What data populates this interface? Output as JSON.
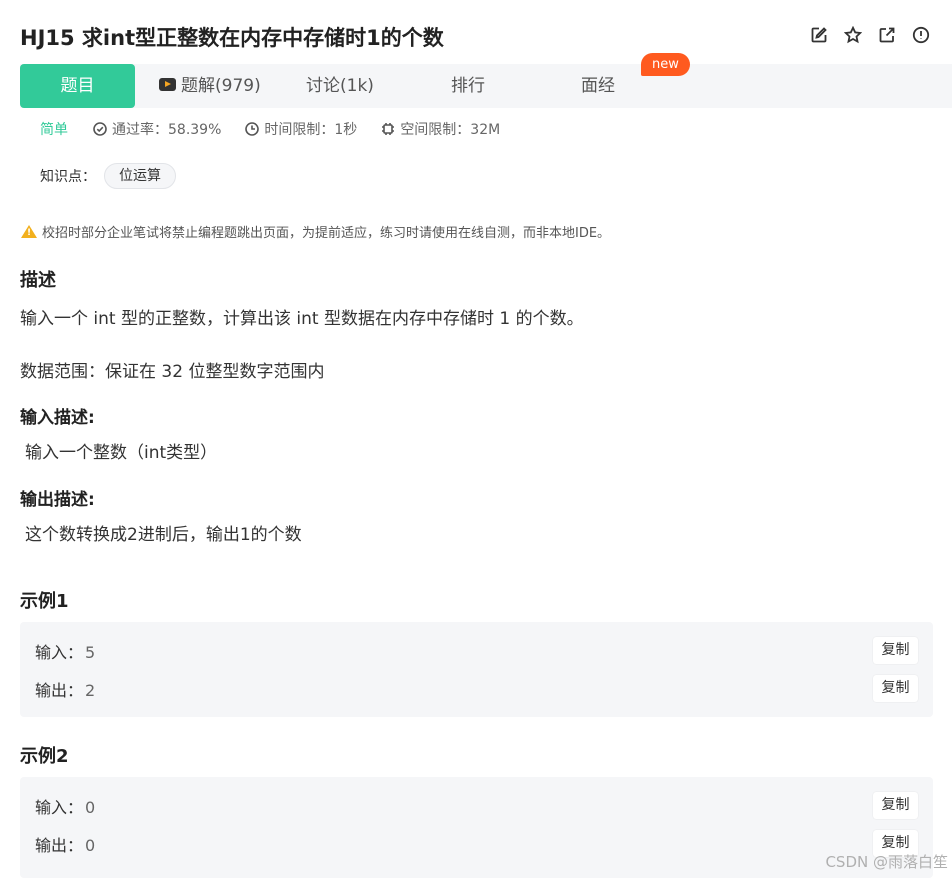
{
  "header": {
    "title": "HJ15  求int型正整数在内存中存储时1的个数",
    "icons": [
      "edit-icon",
      "star-icon",
      "share-icon",
      "report-icon"
    ]
  },
  "tabs": {
    "problem": "题目",
    "solutions": "题解(979)",
    "discuss": "讨论(1k)",
    "rank": "排行",
    "interview": "面经",
    "new_badge": "new"
  },
  "meta": {
    "difficulty": "简单",
    "pass_rate": "通过率：58.39%",
    "time_limit": "时间限制：1秒",
    "space_limit": "空间限制：32M"
  },
  "knowledge": {
    "label": "知识点：",
    "tag": "位运算"
  },
  "warning": "校招时部分企业笔试将禁止编程题跳出页面，为提前适应，练习时请使用在线自测，而非本地IDE。",
  "description": {
    "heading": "描述",
    "text": "输入一个 int 型的正整数，计算出该 int 型数据在内存中存储时 1 的个数。",
    "range": "数据范围：保证在 32 位整型数字范围内"
  },
  "input_desc": {
    "heading": "输入描述:",
    "text": "输入一个整数（int类型）"
  },
  "output_desc": {
    "heading": "输出描述:",
    "text": "这个数转换成2进制后，输出1的个数"
  },
  "examples": [
    {
      "heading": "示例1",
      "input_label": "输入：",
      "input_value": "5",
      "output_label": "输出：",
      "output_value": "2",
      "copy_label": "复制"
    },
    {
      "heading": "示例2",
      "input_label": "输入：",
      "input_value": "0",
      "output_label": "输出：",
      "output_value": "0",
      "copy_label": "复制"
    }
  ],
  "watermark": "CSDN @雨落白笙",
  "colors": {
    "accent": "#32ca99",
    "new_badge": "#ff5a1f",
    "warning": "#f2b01e"
  }
}
